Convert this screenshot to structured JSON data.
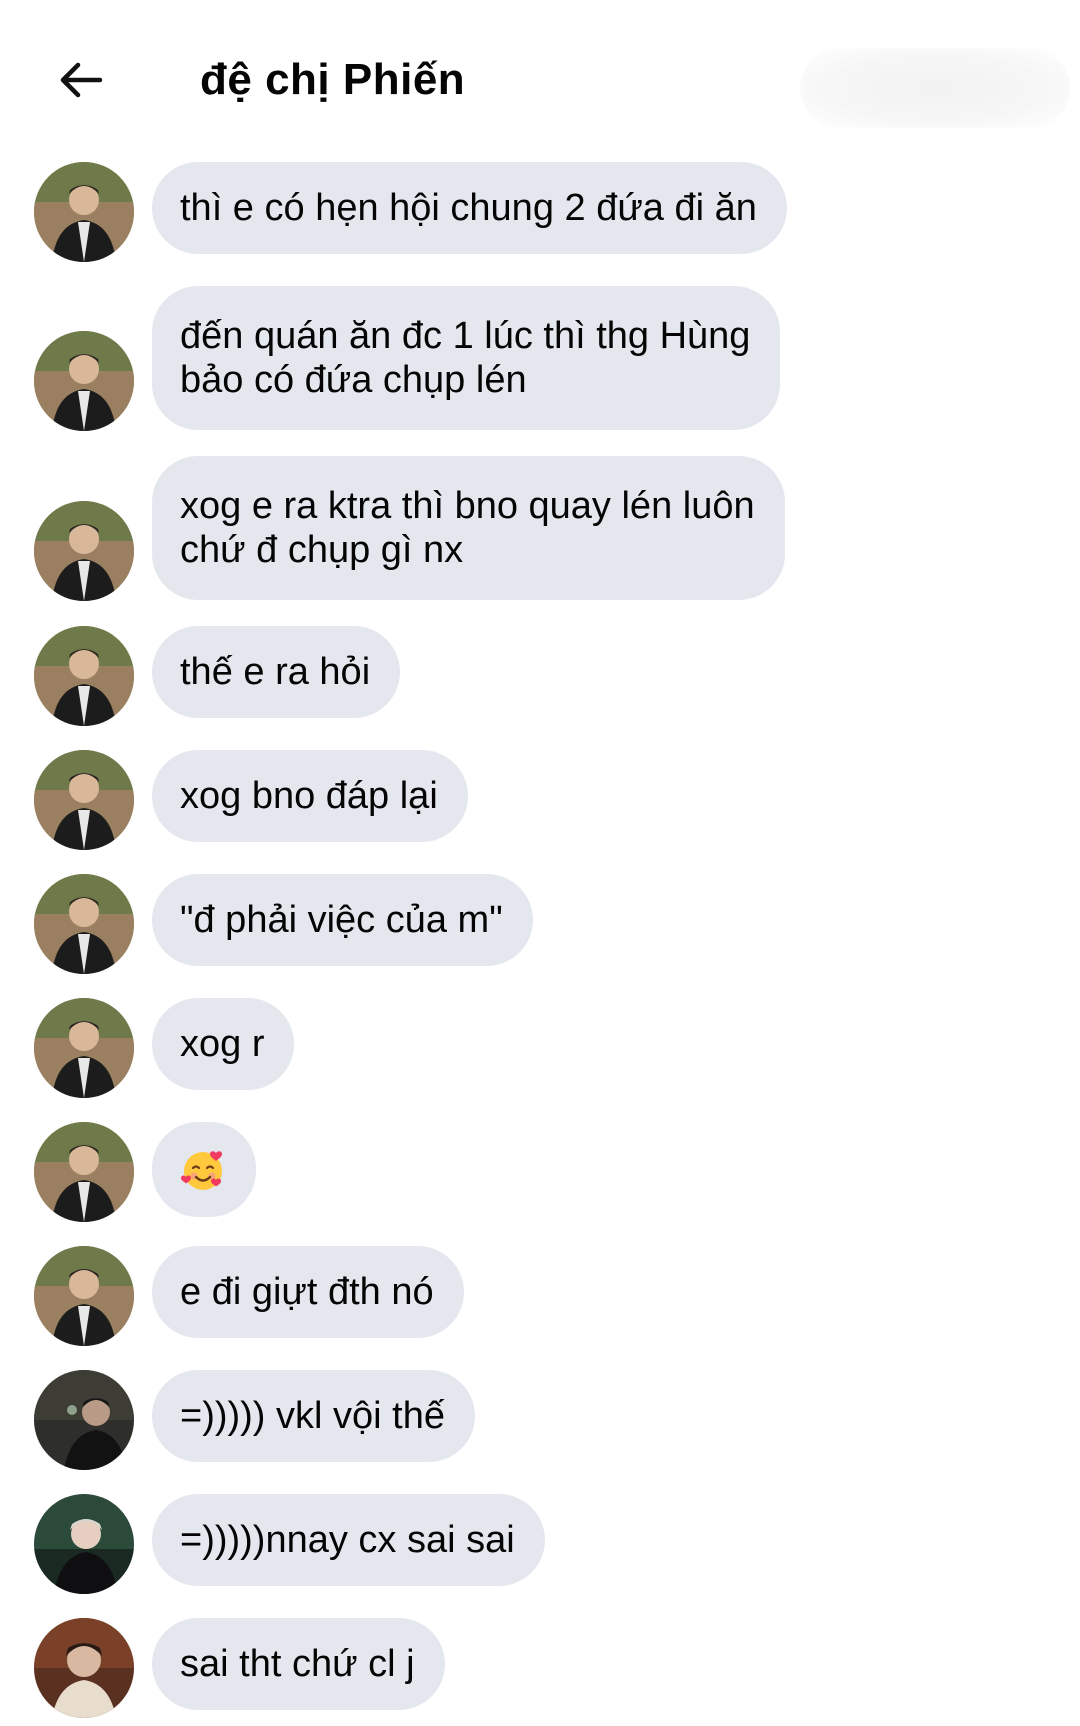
{
  "header": {
    "title": "đệ chị Phiến",
    "back_icon": "arrow-left-icon"
  },
  "messages": [
    {
      "sender": "avatar-a",
      "lines": [
        "thì e có hẹn hội chung 2 đứa đi ăn"
      ]
    },
    {
      "sender": "avatar-a",
      "lines": [
        "đến quán ăn đc 1 lúc thì thg Hùng",
        "bảo có đứa chụp lén"
      ]
    },
    {
      "sender": "avatar-a",
      "lines": [
        "xog e ra ktra thì bno quay lén luôn",
        "chứ đ chụp gì nx"
      ]
    },
    {
      "sender": "avatar-a",
      "lines": [
        "thế e ra hỏi"
      ]
    },
    {
      "sender": "avatar-a",
      "lines": [
        "xog bno đáp lại"
      ]
    },
    {
      "sender": "avatar-a",
      "lines": [
        "\"đ phải việc của m\""
      ]
    },
    {
      "sender": "avatar-a",
      "lines": [
        "xog r"
      ]
    },
    {
      "sender": "avatar-a",
      "emoji": "smiling-face-with-hearts-icon"
    },
    {
      "sender": "avatar-a",
      "lines": [
        "e đi giựt đth nó"
      ]
    },
    {
      "sender": "avatar-b",
      "lines": [
        "=))))) vkl vội thế"
      ]
    },
    {
      "sender": "avatar-c",
      "lines": [
        "=)))))nnay cx sai sai"
      ]
    },
    {
      "sender": "avatar-d",
      "lines": [
        "sai tht chứ cl j"
      ]
    }
  ],
  "colors": {
    "bubble": "#e4e8ee",
    "text": "#050505",
    "background": "#ffffff"
  }
}
